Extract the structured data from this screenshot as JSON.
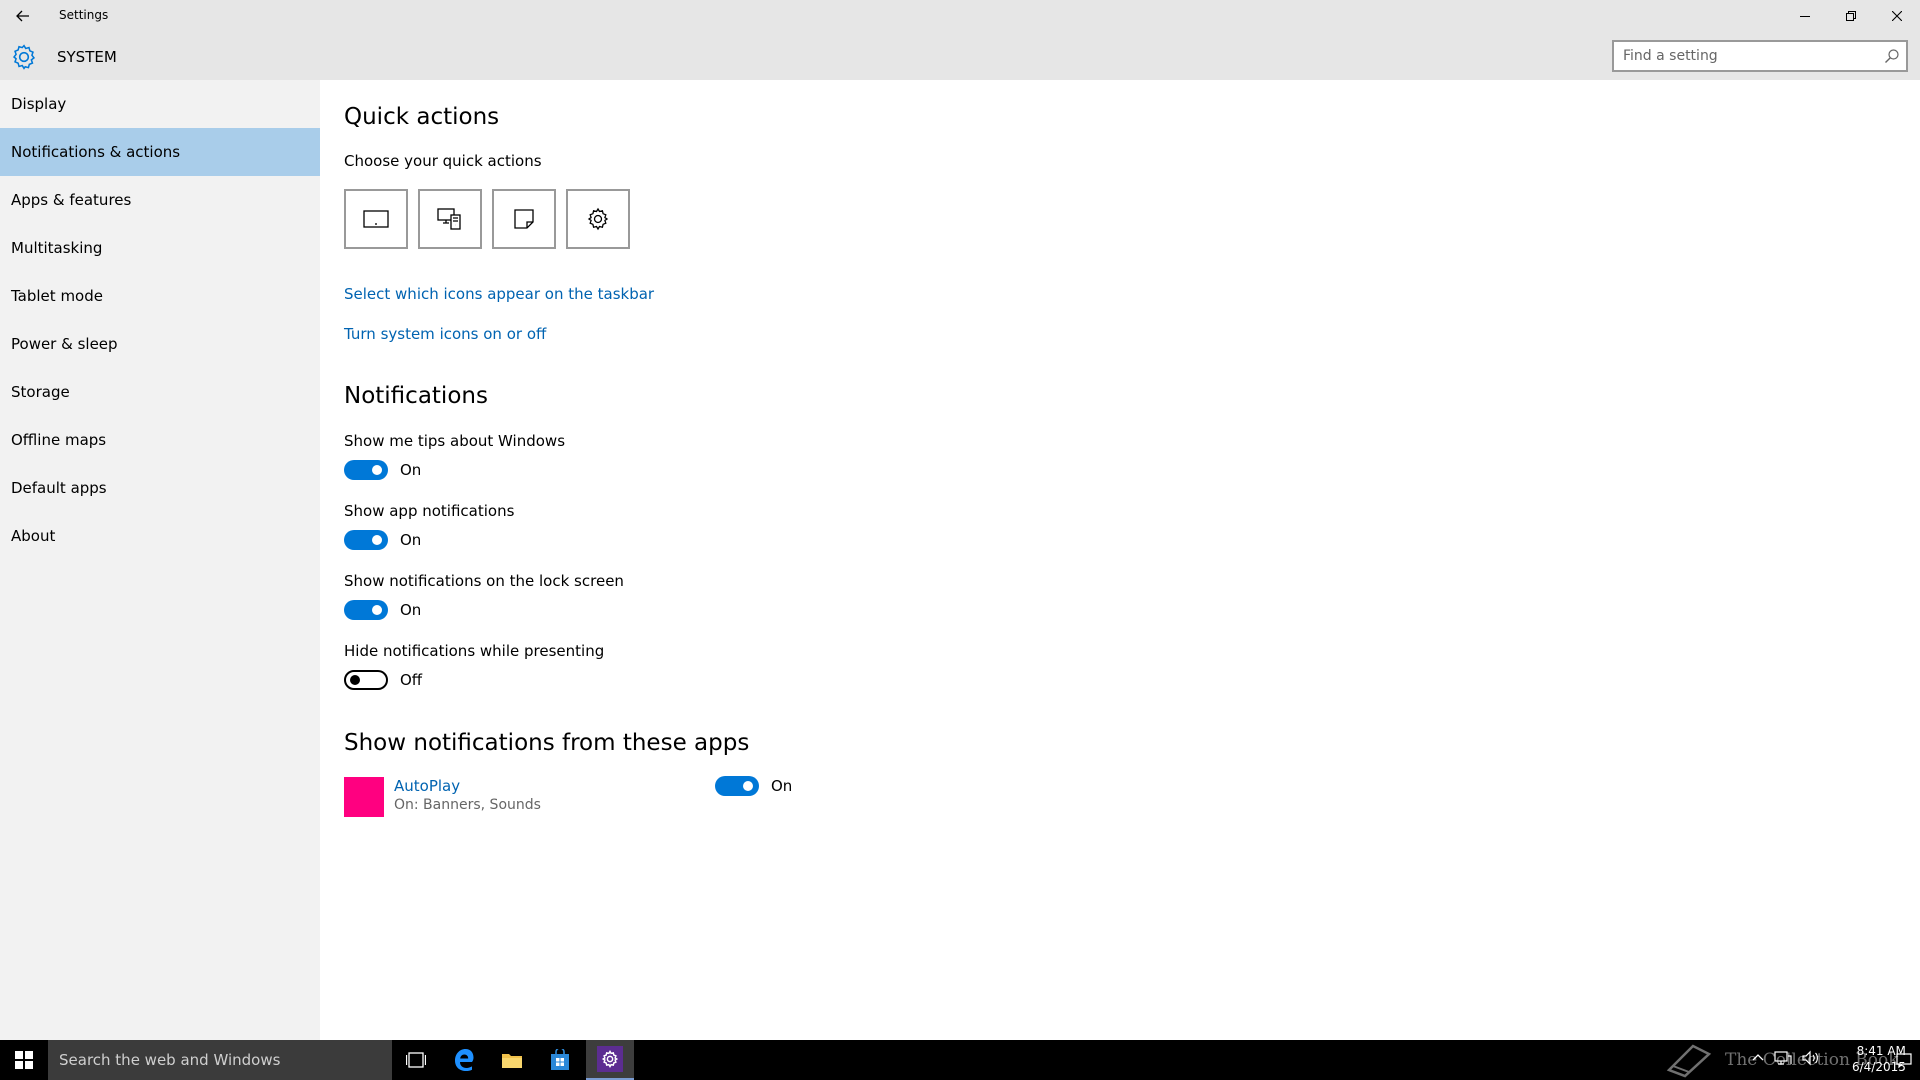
{
  "window": {
    "title": "Settings"
  },
  "header": {
    "section": "SYSTEM",
    "search_placeholder": "Find a setting"
  },
  "sidebar": {
    "items": [
      {
        "label": "Display"
      },
      {
        "label": "Notifications & actions",
        "active": true
      },
      {
        "label": "Apps & features"
      },
      {
        "label": "Multitasking"
      },
      {
        "label": "Tablet mode"
      },
      {
        "label": "Power & sleep"
      },
      {
        "label": "Storage"
      },
      {
        "label": "Offline maps"
      },
      {
        "label": "Default apps"
      },
      {
        "label": "About"
      }
    ]
  },
  "quick_actions": {
    "heading": "Quick actions",
    "subtitle": "Choose your quick actions",
    "tiles": [
      "tablet-mode-icon",
      "connect-icon",
      "note-icon",
      "settings-gear-icon"
    ],
    "link1": "Select which icons appear on the taskbar",
    "link2": "Turn system icons on or off"
  },
  "notifications": {
    "heading": "Notifications",
    "settings": [
      {
        "label": "Show me tips about Windows",
        "state": "On"
      },
      {
        "label": "Show app notifications",
        "state": "On"
      },
      {
        "label": "Show notifications on the lock screen",
        "state": "On"
      },
      {
        "label": "Hide notifications while presenting",
        "state": "Off"
      }
    ]
  },
  "apps": {
    "heading": "Show notifications from these apps",
    "list": [
      {
        "name": "AutoPlay",
        "detail": "On: Banners, Sounds",
        "state": "On",
        "color": "#ff0080"
      }
    ]
  },
  "taskbar": {
    "search_placeholder": "Search the web and Windows",
    "watermark": "The Collection Book",
    "time": "8:41 AM",
    "date": "6/4/2015"
  },
  "colors": {
    "accent": "#0078d7",
    "link": "#0063b1",
    "selected": "#a9cdea"
  }
}
